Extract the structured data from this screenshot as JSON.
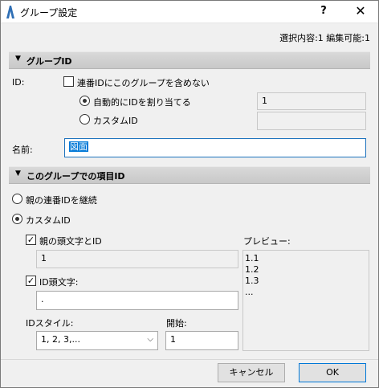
{
  "window": {
    "title": "グループ設定",
    "help_label": "?",
    "close_label": "✕"
  },
  "status": "選択内容:1 編集可能:1",
  "group_id_section": {
    "title": "グループID",
    "id_label": "ID:",
    "exclude_checkbox_label": "連番IDにこのグループを含めない",
    "auto_assign_label": "自動的にIDを割り当てる",
    "auto_assign_value": "1",
    "custom_id_label": "カスタムID",
    "custom_id_value": ""
  },
  "name": {
    "label": "名前:",
    "value": "図面"
  },
  "item_id_section": {
    "title": "このグループでの項目ID",
    "inherit_label": "親の連番IDを継続",
    "custom_label": "カスタムID",
    "parent_prefix_label": "親の頭文字とID",
    "parent_prefix_value": "1",
    "id_prefix_label": "ID頭文字:",
    "id_prefix_value": ".",
    "id_style_label": "IDスタイル:",
    "id_style_value": "1, 2, 3,...",
    "start_label": "開始:",
    "start_value": "1",
    "preview_label": "プレビュー:",
    "preview_lines": [
      "1.1",
      "1.2",
      "1.3",
      "..."
    ]
  },
  "buttons": {
    "cancel": "キャンセル",
    "ok": "OK"
  },
  "colors": {
    "accent": "#0078d7",
    "title_bar": "#ffffff",
    "background": "#f0f0f0"
  }
}
